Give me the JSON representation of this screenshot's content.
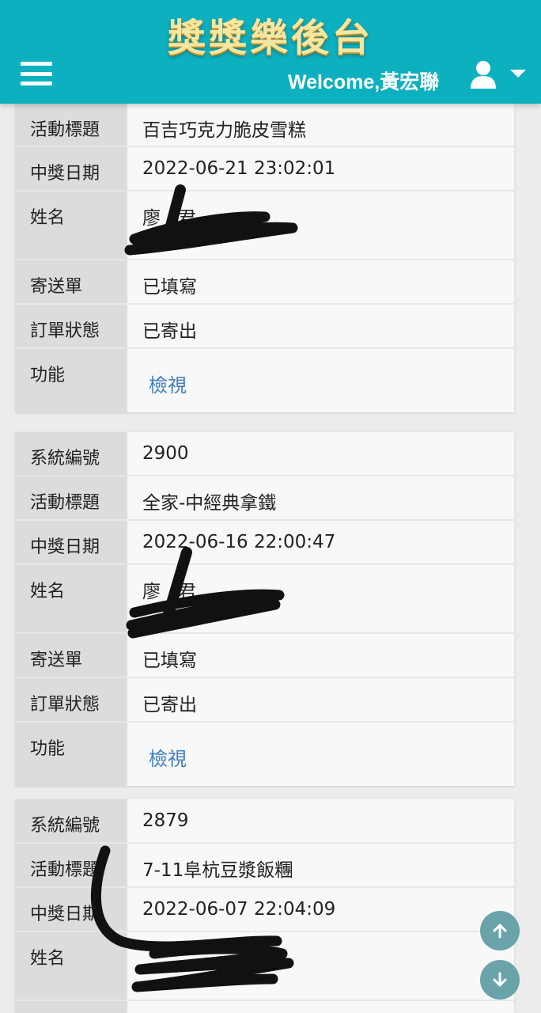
{
  "header": {
    "brand": "獎獎樂後台",
    "welcome": "Welcome,黃宏聯"
  },
  "labels": {
    "id": "系統編號",
    "title": "活動標題",
    "date": "中獎日期",
    "name": "姓名",
    "sheet": "寄送單",
    "status": "訂單狀態",
    "function": "功能",
    "view": "檢視"
  },
  "records": [
    {
      "title": "百吉巧克力脆皮雪糕",
      "date": "2022-06-21 23:02:01",
      "name": "廖",
      "name2": "君",
      "sheet": "已填寫",
      "status": "已寄出"
    },
    {
      "id": "2900",
      "title": "全家-中經典拿鐵",
      "date": "2022-06-16 22:00:47",
      "name": "廖",
      "name2": "君",
      "sheet": "已填寫",
      "status": "已寄出"
    },
    {
      "id": "2879",
      "title": "7-11阜杭豆漿飯糰",
      "date": "2022-06-07 22:04:09"
    }
  ],
  "icons": {
    "menu": "hamburger-menu-icon",
    "user": "user-icon",
    "dropdown": "caret-down-icon",
    "up": "arrow-up-icon",
    "down": "arrow-down-icon"
  },
  "colors": {
    "header": "#0db0bf",
    "brand": "#f7e6a0",
    "link": "#3f7fbf",
    "fab": "#6aa3a9"
  }
}
